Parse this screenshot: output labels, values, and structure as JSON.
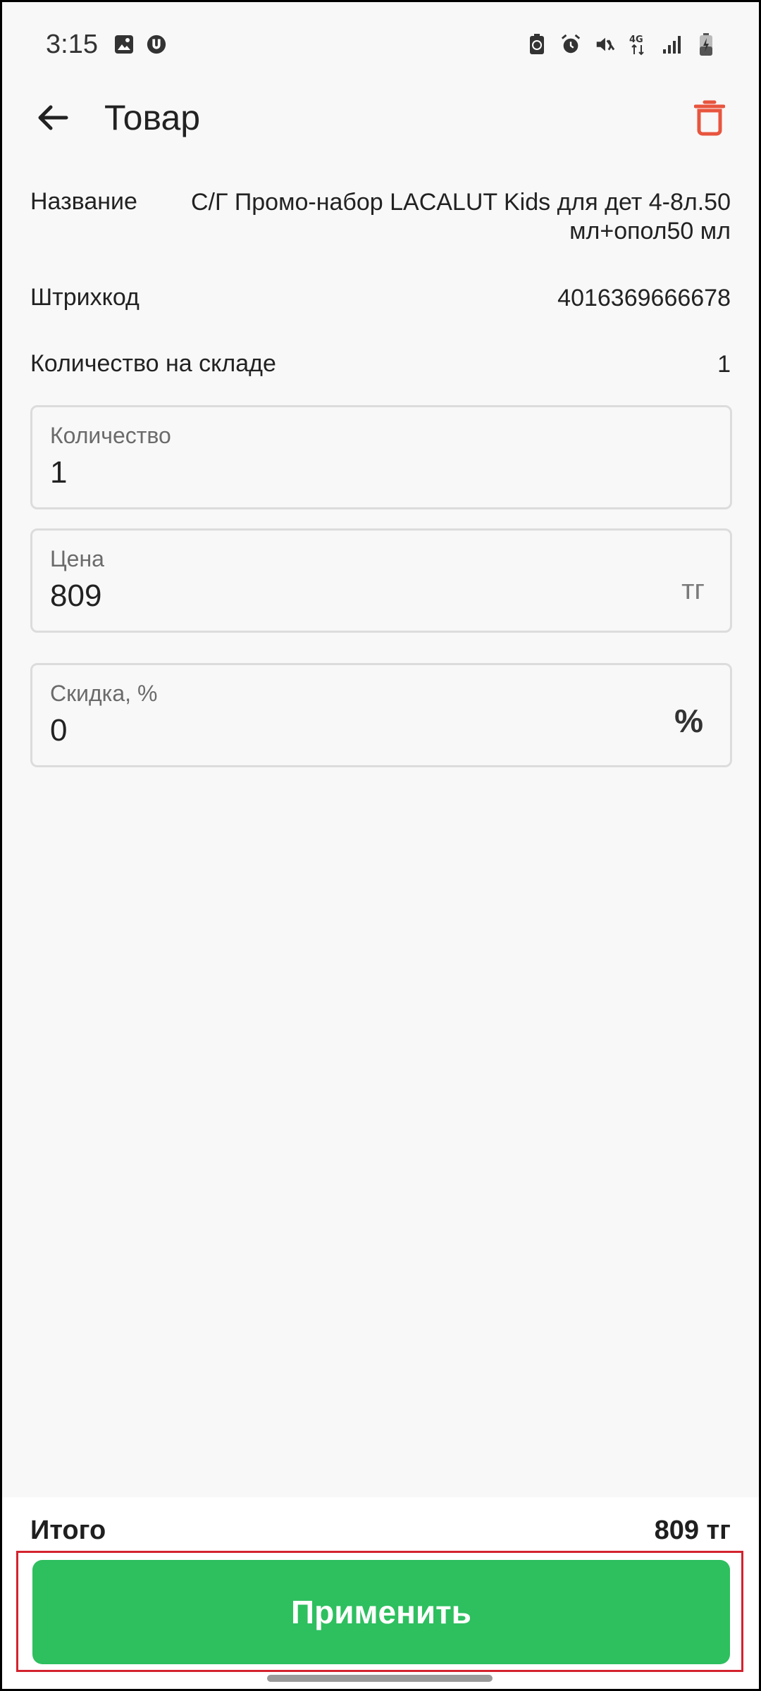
{
  "status_bar": {
    "time": "3:15",
    "left_icons": [
      "image-icon",
      "u-badge-icon"
    ],
    "right_icons": [
      "recycle-battery-icon",
      "alarm-icon",
      "mute-icon",
      "4g-icon",
      "signal-icon",
      "battery-charging-icon"
    ],
    "network_label": "4G"
  },
  "app_bar": {
    "title": "Товар",
    "back_icon": "arrow-left-icon",
    "delete_icon": "trash-icon",
    "accent_color": "#e8553e"
  },
  "info": {
    "name_label": "Название",
    "name_value": "С/Г Промо-набор LACALUT Kids для дет 4-8л.50 мл+опол50 мл",
    "barcode_label": "Штрихкод",
    "barcode_value": "4016369666678",
    "stock_label": "Количество на складе",
    "stock_value": "1"
  },
  "fields": {
    "quantity": {
      "label": "Количество",
      "value": "1"
    },
    "price": {
      "label": "Цена",
      "value": "809",
      "suffix": "тг"
    },
    "discount": {
      "label": "Скидка, %",
      "value": "0",
      "suffix": "%"
    }
  },
  "summary": {
    "total_label": "Итого",
    "total_value": "809 тг"
  },
  "actions": {
    "apply_label": "Применить",
    "apply_color": "#2ebf5f"
  }
}
